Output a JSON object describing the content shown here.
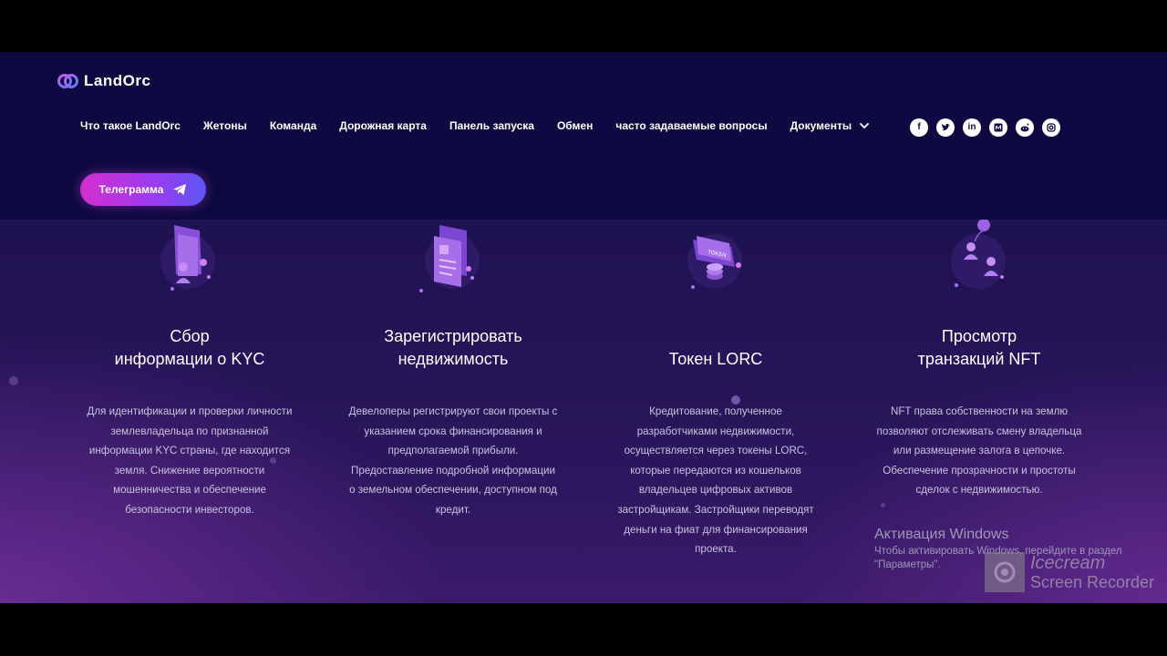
{
  "header": {
    "logo_text": "LandOrc",
    "nav": [
      {
        "label": "Что такое LandOrc"
      },
      {
        "label": "Жетоны"
      },
      {
        "label": "Команда"
      },
      {
        "label": "Дорожная карта"
      },
      {
        "label": "Панель запуска"
      },
      {
        "label": "Обмен"
      },
      {
        "label": "часто задаваемые вопросы"
      },
      {
        "label": "Документы"
      }
    ],
    "socials": [
      "facebook-icon",
      "twitter-icon",
      "linkedin-icon",
      "medium-icon",
      "reddit-icon",
      "instagram-icon"
    ],
    "telegram_button": "Телеграмма"
  },
  "features": [
    {
      "icon": "kyc-folder-user-icon",
      "title_line1": "Сбор",
      "title_line2": "информации о KYC",
      "text": [
        "Для идентификации и проверки личности",
        "землевладельца по признанной",
        "информации KYC страны, где находится",
        "земля. Снижение вероятности",
        "мошенничества и обеспечение",
        "безопасности инвесторов."
      ]
    },
    {
      "icon": "register-property-document-icon",
      "title_line1": "Зарегистрировать",
      "title_line2": "недвижимость",
      "text": [
        "Девелоперы регистрируют свои проекты с",
        "указанием срока финансирования и",
        "предполагаемой прибыли.",
        "Предоставление подробной информации",
        "о земельном обеспечении, доступном под",
        "кредит."
      ]
    },
    {
      "icon": "token-coins-icon",
      "title_line1": "",
      "title_line2": "Токен LORC",
      "text": [
        "Кредитование, полученное",
        "разработчиками недвижимости,",
        "осуществляется через токены LORC,",
        "которые передаются из кошельков",
        "владельцев цифровых активов",
        "застройщикам. Застройщики переводят",
        "деньги на фиат для финансирования",
        "проекта."
      ]
    },
    {
      "icon": "nft-transactions-users-icon",
      "title_line1": "Просмотр",
      "title_line2": "транзакций NFT",
      "text": [
        "NFT права собственности на землю",
        "позволяют отслеживать смену владельца",
        "или размещение залога в цепочке.",
        "Обеспечение прозрачности и простоты",
        "сделок с недвижимостью."
      ]
    }
  ],
  "icon_badge_text": "TOKEN",
  "overlays": {
    "windows_title": "Активация Windows",
    "windows_line1": "Чтобы активировать Windows, перейдите в раздел",
    "windows_line2": "\"Параметры\".",
    "recorder_line1": "Icecream",
    "recorder_line2": "Screen Recorder"
  },
  "colors": {
    "header_bg": "#0e0940",
    "button_gradient_start": "#d22fcf",
    "button_gradient_end": "#5b56f2",
    "icon_purple": "#9b5de5"
  }
}
